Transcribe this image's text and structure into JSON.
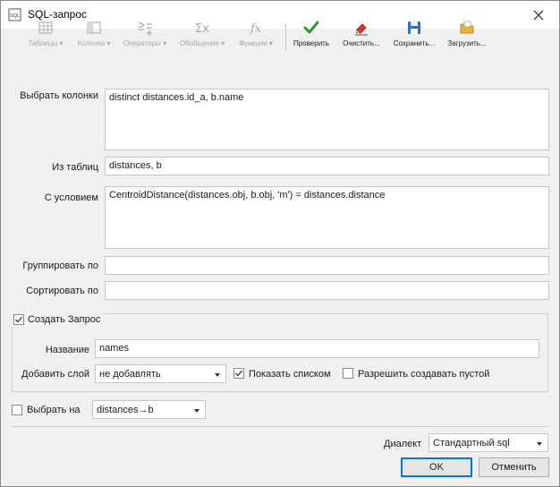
{
  "window": {
    "title": "SQL-запрос"
  },
  "toolbar": {
    "tables": "Таблицы",
    "columns": "Колонки",
    "operators": "Операторы",
    "aggregate": "Обобщение",
    "functions": "Функции",
    "check": "Проверить",
    "clear": "Очистить...",
    "save": "Сохранить...",
    "load": "Загрузить..."
  },
  "form": {
    "select_label": "Выбрать колонки",
    "select_value": "distinct distances.id_a, b.name",
    "from_label": "Из таблиц",
    "from_value": "distances, b",
    "where_label": "С условием",
    "where_value": "CentroidDistance(distances.obj,  b.obj, 'm') = distances.distance",
    "group_label": "Группировать по",
    "group_value": "",
    "order_label": "Сортировать по",
    "order_value": ""
  },
  "create_query": {
    "label": "Создать Запрос",
    "checked": true,
    "name_label": "Название",
    "name_value": "names",
    "add_layer_label": "Добавить слой",
    "add_layer_value": "не добавлять",
    "show_list_label": "Показать списком",
    "show_list_checked": true,
    "allow_empty_label": "Разрешить создавать пустой",
    "allow_empty_checked": false
  },
  "select_on": {
    "label": "Выбрать на",
    "checked": false,
    "value": "distances→b"
  },
  "dialect": {
    "label": "Диалект",
    "value": "Стандартный sql"
  },
  "buttons": {
    "ok": "OK",
    "cancel": "Отменить"
  },
  "colors": {
    "check_green": "#2e9a2e",
    "disk_blue": "#2f6fc0",
    "eraser_red": "#d9342b",
    "folder_yellow": "#e8b53a"
  }
}
